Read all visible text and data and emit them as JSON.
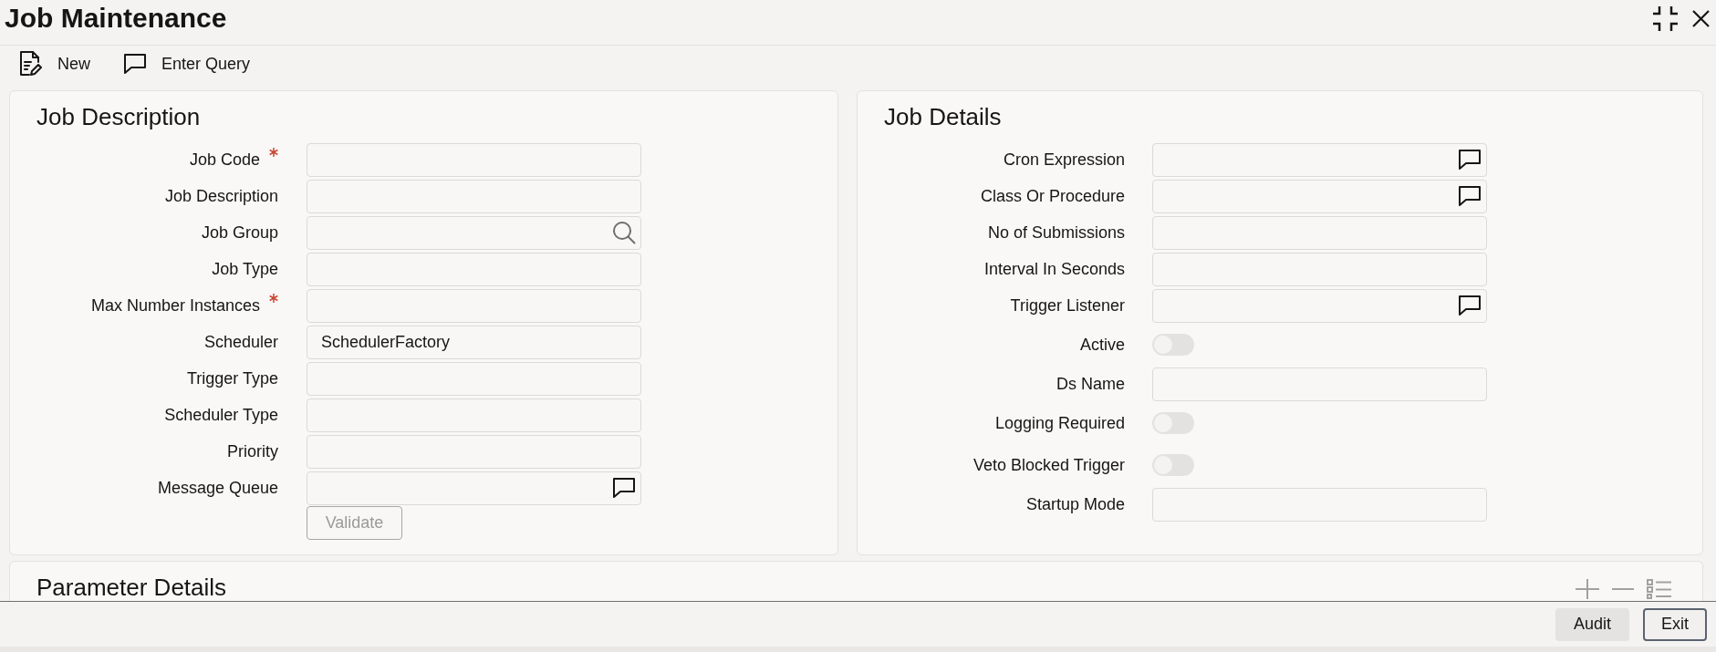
{
  "window": {
    "title": "Job Maintenance"
  },
  "toolbar": [
    {
      "kind": "new",
      "label": "New"
    },
    {
      "kind": "query",
      "label": "Enter Query"
    }
  ],
  "job_description": {
    "title": "Job Description",
    "fields": [
      {
        "label": "Job Code",
        "kind": "text",
        "required": true
      },
      {
        "label": "Job Description",
        "kind": "text",
        "required": false
      },
      {
        "label": "Job Group",
        "kind": "lookup",
        "required": false
      },
      {
        "label": "Job Type",
        "kind": "text",
        "required": false
      },
      {
        "label": "Max Number Instances",
        "kind": "text",
        "required": true
      },
      {
        "label": "Scheduler",
        "kind": "text",
        "required": false,
        "value": "SchedulerFactory"
      },
      {
        "label": "Trigger Type",
        "kind": "text",
        "required": false
      },
      {
        "label": "Scheduler Type",
        "kind": "text",
        "required": false
      },
      {
        "label": "Priority",
        "kind": "text",
        "required": false
      },
      {
        "label": "Message Queue",
        "kind": "popup",
        "required": false
      }
    ],
    "button": {
      "label": "Validate",
      "disabled": true
    }
  },
  "job_details": {
    "title": "Job Details",
    "fields": [
      {
        "label": "Cron Expression",
        "kind": "popup"
      },
      {
        "label": "Class Or Procedure",
        "kind": "popup"
      },
      {
        "label": "No of Submissions",
        "kind": "text"
      },
      {
        "label": "Interval In Seconds",
        "kind": "text"
      },
      {
        "label": "Trigger Listener",
        "kind": "popup"
      },
      {
        "label": "Active",
        "kind": "toggle",
        "on": false
      },
      {
        "label": "Ds Name",
        "kind": "text"
      },
      {
        "label": "Logging Required",
        "kind": "toggle",
        "on": false
      },
      {
        "label": "Veto Blocked Trigger",
        "kind": "toggle",
        "on": false
      },
      {
        "label": "Startup Mode",
        "kind": "text"
      }
    ]
  },
  "parameter_details": {
    "title": "Parameter Details"
  },
  "footer": {
    "buttons": [
      {
        "label": "Audit",
        "focused": false
      },
      {
        "label": "Exit",
        "focused": true
      }
    ]
  }
}
